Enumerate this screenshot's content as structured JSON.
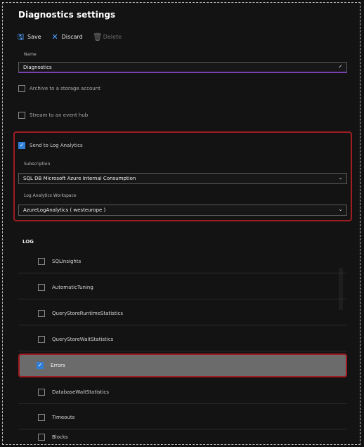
{
  "window": {
    "title": "Diagnostics settings"
  },
  "toolbar": {
    "save_label": "Save",
    "discard_label": "Discard",
    "delete_label": "Delete"
  },
  "name_field": {
    "label": "Name",
    "value": "Diagnostics"
  },
  "destinations": {
    "archive_label": "Archive to a storage account",
    "archive_checked": false,
    "stream_label": "Stream to an event hub",
    "stream_checked": false,
    "log_analytics_label": "Send to Log Analytics",
    "log_analytics_checked": true
  },
  "subscription": {
    "label": "Subscription",
    "value": "SQL DB Microsoft Azure Internal Consumption"
  },
  "workspace": {
    "label": "Log Analytics Workspace",
    "value": "AzureLogAnalytics ( westeurope )"
  },
  "log_section": {
    "label": "LOG"
  },
  "log_items": [
    {
      "label": "SQLInsights",
      "checked": false
    },
    {
      "label": "AutomaticTuning",
      "checked": false
    },
    {
      "label": "QueryStoreRuntimeStatistics",
      "checked": false
    },
    {
      "label": "QueryStoreWaitStatistics",
      "checked": false
    },
    {
      "label": "Errors",
      "checked": true
    },
    {
      "label": "DatabaseWaitStatistics",
      "checked": false
    },
    {
      "label": "Timeouts",
      "checked": false
    },
    {
      "label": "Blocks",
      "checked": false
    }
  ],
  "colors": {
    "background": "#111111",
    "highlight_border": "#9e1c22",
    "accent": "#2f7fd8",
    "name_underline": "#7a3fb0",
    "selected_row": "#6b6b6b"
  }
}
